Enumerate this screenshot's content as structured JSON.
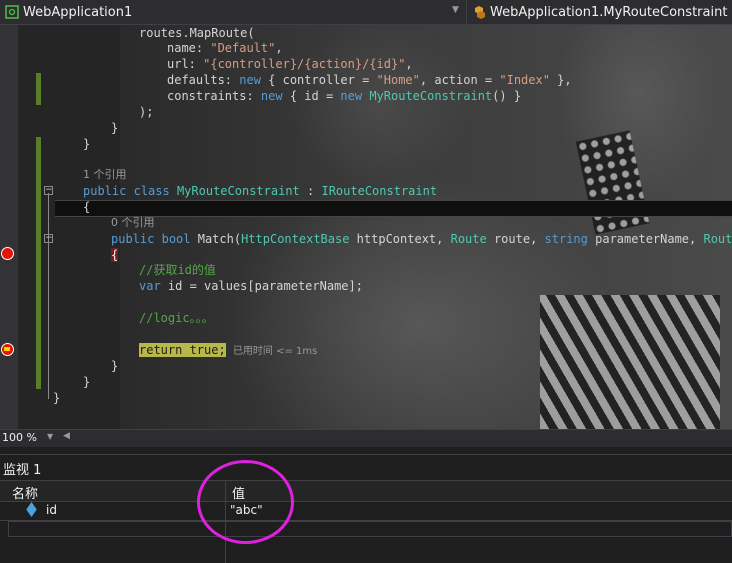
{
  "navbar": {
    "project": "WebApplication1",
    "member": "WebApplication1.MyRouteConstraint"
  },
  "code": {
    "l1": "routes.MapRoute(",
    "l2_key": "name: ",
    "l2_val": "\"Default\"",
    "l2_end": ",",
    "l3_key": "url: ",
    "l3_val": "\"{controller}/{action}/{id}\"",
    "l3_end": ",",
    "l4_a": "defaults: ",
    "l4_new": "new",
    "l4_b": " { controller = ",
    "l4_home": "\"Home\"",
    "l4_c": ", action = ",
    "l4_index": "\"Index\"",
    "l4_d": " },",
    "l5_a": "constraints: ",
    "l5_new": "new",
    "l5_b": " { id = ",
    "l5_new2": "new",
    "l5_type": "MyRouteConstraint",
    "l5_c": "() }",
    "l6": ");",
    "l7": "}",
    "l8": "}",
    "lens1": "1 个引用",
    "cls_public": "public",
    "cls_class": "class",
    "cls_name": "MyRouteConstraint",
    "cls_colon": " : ",
    "cls_iface": "IRouteConstraint",
    "open1": "{",
    "lens2": "0 个引用",
    "m_public": "public",
    "m_bool": "bool",
    "m_name": " Match(",
    "m_t1": "HttpContextBase",
    "m_p1": " httpContext, ",
    "m_t2": "Route",
    "m_p2": " route, ",
    "m_t3": "string",
    "m_p3": " parameterName, ",
    "m_t4": "RouteVa",
    "open2": "{",
    "comment1": "//获取id的值",
    "var_kw": "var",
    "var_rest": " id = values[parameterName];",
    "comment2": "//logic。。。",
    "ret": "return true;",
    "perf": "已用时间 <= 1ms",
    "close2": "}",
    "close1": "}"
  },
  "zoom": {
    "level": "100 %"
  },
  "watch": {
    "title": "监视 1",
    "col_name": "名称",
    "col_value": "值",
    "rows": [
      {
        "name": "id",
        "value": "\"abc\""
      }
    ]
  },
  "colors": {
    "annotation_circle": "#e020e0",
    "breakpoint": "#e51400",
    "current_statement": "#b8b84a"
  }
}
